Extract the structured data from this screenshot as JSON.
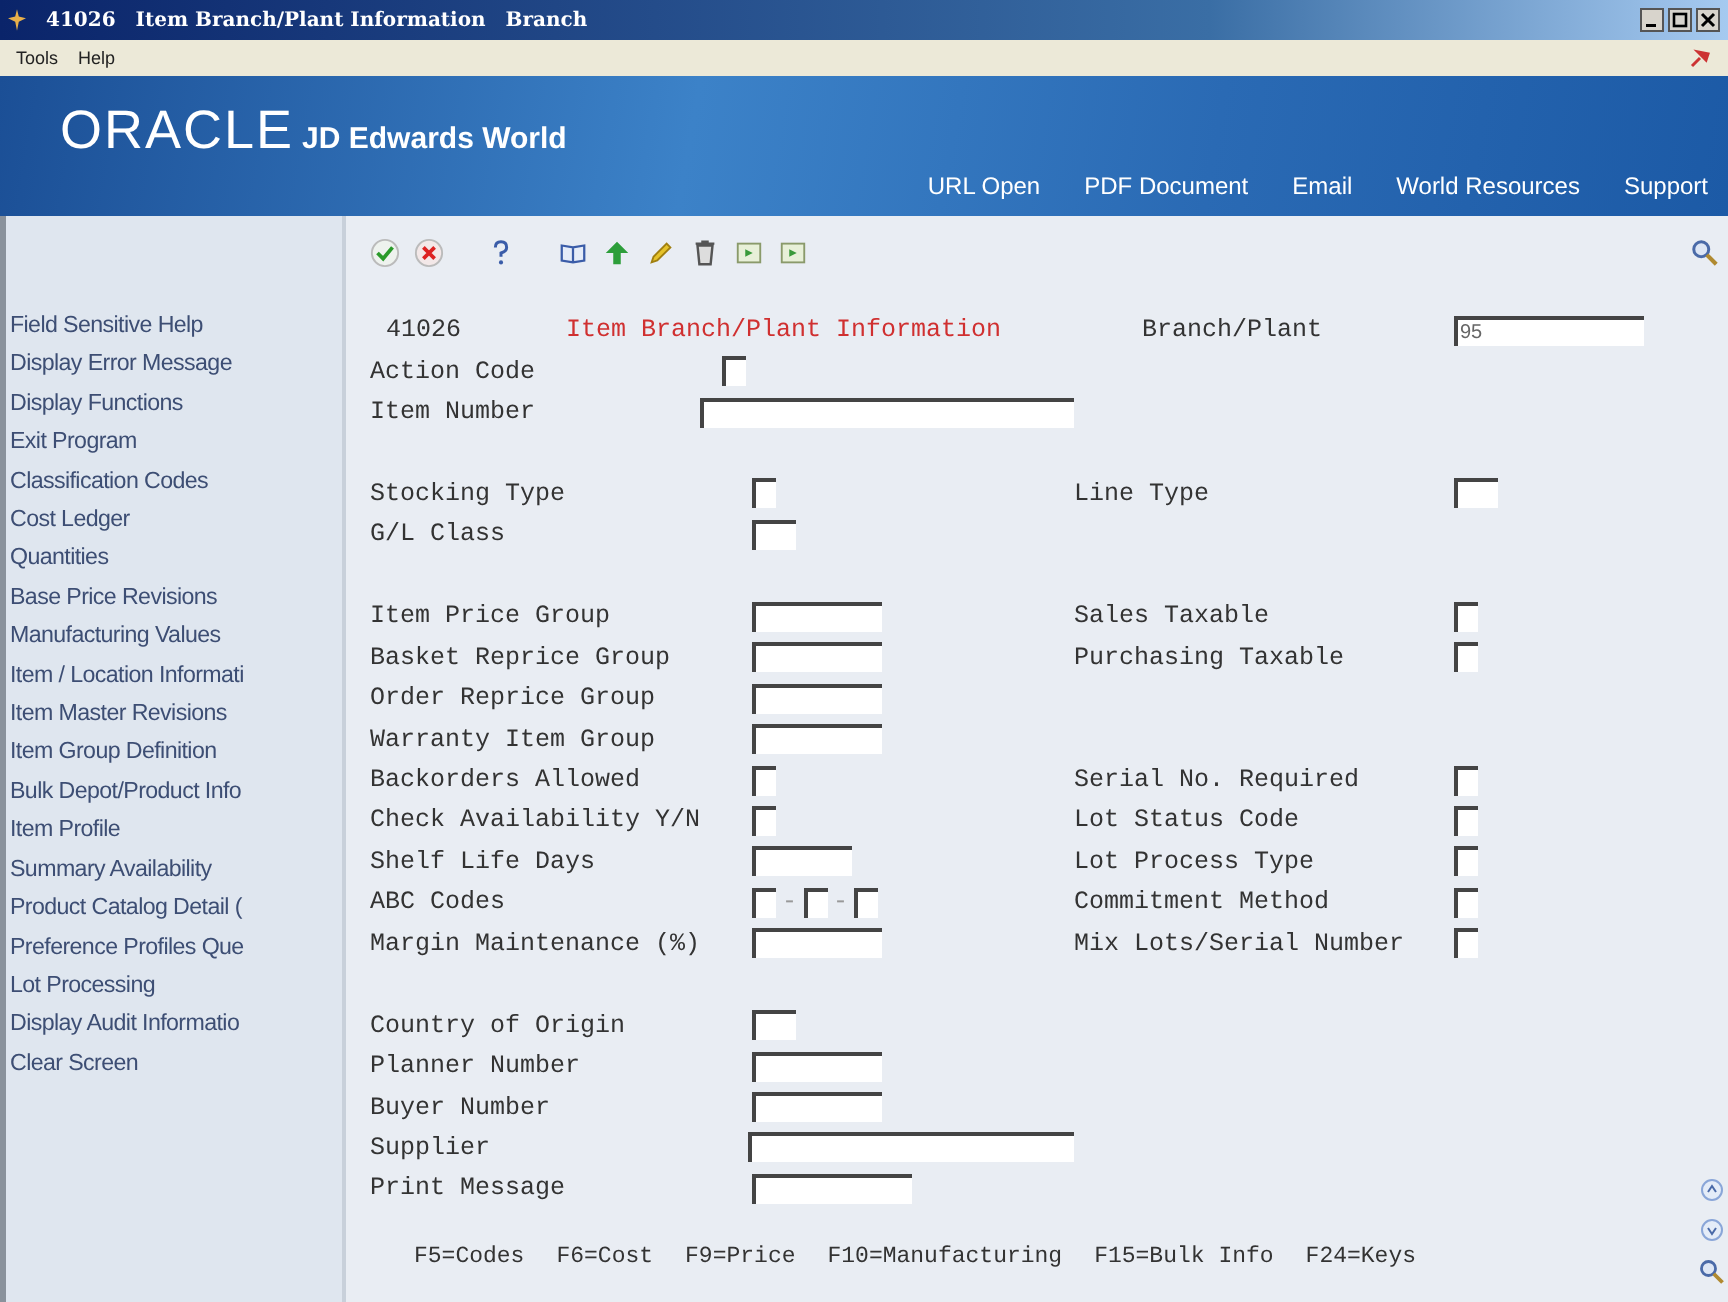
{
  "window": {
    "program": "41026",
    "title": "Item Branch/Plant Information",
    "subtitle": "Branch"
  },
  "menu": [
    "Tools",
    "Help"
  ],
  "banner": {
    "logo": "ORACLE",
    "product": "JD Edwards World",
    "links": [
      "URL Open",
      "PDF Document",
      "Email",
      "World Resources",
      "Support"
    ]
  },
  "sidebar": {
    "items": [
      "Field Sensitive Help",
      "Display Error Message",
      "Display Functions",
      "Exit Program",
      "Classification Codes",
      "Cost Ledger",
      "Quantities",
      "Base Price Revisions",
      "Manufacturing Values",
      "Item / Location Informati",
      "Item Master Revisions",
      "Item Group Definition",
      "Bulk Depot/Product Info",
      "Item Profile",
      "Summary Availability",
      "Product Catalog Detail (",
      "Preference Profiles Que",
      "Lot Processing",
      "Display Audit Informatio",
      "Clear Screen"
    ]
  },
  "form": {
    "program_id": "41026",
    "title": "Item Branch/Plant Information",
    "branch_plant": {
      "label": "Branch/Plant",
      "value": "95"
    },
    "sections": [
      [
        {
          "left": {
            "label": "Action Code",
            "kind": "key_flag"
          }
        },
        {
          "left": {
            "label": "Item Number",
            "kind": "item"
          }
        }
      ],
      [
        {
          "left": {
            "label": "Stocking Type",
            "kind": "flag"
          },
          "right": {
            "label": "Line Type",
            "kind": "code"
          }
        },
        {
          "left": {
            "label": "G/L Class",
            "kind": "code"
          }
        }
      ],
      [
        {
          "left": {
            "label": "Item Price Group",
            "kind": "group"
          },
          "right": {
            "label": "Sales Taxable",
            "kind": "flag"
          }
        },
        {
          "left": {
            "label": "Basket Reprice Group",
            "kind": "group"
          },
          "right": {
            "label": "Purchasing Taxable",
            "kind": "flag"
          }
        },
        {
          "left": {
            "label": "Order Reprice Group",
            "kind": "group"
          }
        },
        {
          "left": {
            "label": "Warranty Item Group",
            "kind": "group"
          }
        },
        {
          "left": {
            "label": "Backorders Allowed",
            "kind": "flag"
          },
          "right": {
            "label": "Serial No. Required",
            "kind": "flag"
          }
        },
        {
          "left": {
            "label": "Check Availability Y/N",
            "kind": "flag"
          },
          "right": {
            "label": "Lot Status Code",
            "kind": "flag"
          }
        },
        {
          "left": {
            "label": "Shelf Life Days",
            "kind": "days"
          },
          "right": {
            "label": "Lot Process Type",
            "kind": "flag"
          }
        },
        {
          "left": {
            "label": "ABC Codes",
            "kind": "abc",
            "separator": "-"
          },
          "right": {
            "label": "Commitment Method",
            "kind": "flag"
          }
        },
        {
          "left": {
            "label": "Margin Maintenance (%)",
            "kind": "group"
          },
          "right": {
            "label": "Mix Lots/Serial Number",
            "kind": "flag"
          }
        }
      ],
      [
        {
          "left": {
            "label": "Country of Origin",
            "kind": "code"
          }
        },
        {
          "left": {
            "label": "Planner Number",
            "kind": "group"
          }
        },
        {
          "left": {
            "label": "Buyer Number",
            "kind": "group"
          }
        },
        {
          "left": {
            "label": "Supplier",
            "kind": "supplier"
          }
        },
        {
          "left": {
            "label": "Print Message",
            "kind": "message"
          }
        }
      ]
    ]
  },
  "function_keys": [
    "F5=Codes",
    "F6=Cost",
    "F9=Price",
    "F10=Manufacturing",
    "F15=Bulk Info",
    "F24=Keys"
  ]
}
